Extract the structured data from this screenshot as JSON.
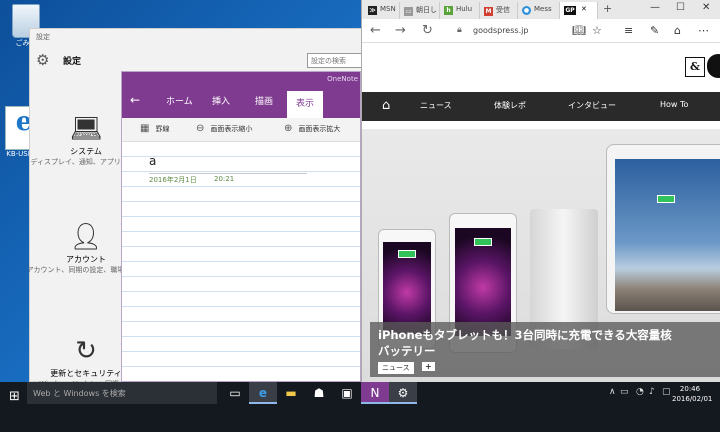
{
  "desktop": {
    "recycle_bin_label": "ごみ箱",
    "ie_shortcut_label": "KB-USB-..."
  },
  "settings": {
    "window_title": "設定",
    "heading": "設定",
    "search_placeholder": "設定の検索",
    "items": [
      {
        "title": "システム",
        "desc": "ディスプレイ、通知、アプリ、電源"
      },
      {
        "title": "アカウント",
        "desc": "アカウント、同期の設定、職場、家族"
      },
      {
        "title": "更新とセキュリティ",
        "desc": "Windows Update、回復、..."
      }
    ]
  },
  "onenote": {
    "app_title": "OneNote",
    "tabs": [
      "ホーム",
      "挿入",
      "描画",
      "表示"
    ],
    "active_tab": "表示",
    "ribbon": [
      "罫線",
      "画面表示縮小",
      "画面表示拡大"
    ],
    "page_title": "a",
    "page_date": "2016年2月1日",
    "page_time": "20:21"
  },
  "edge": {
    "tabs": [
      {
        "label": "MSN",
        "color": "#222222",
        "glyph": "≫"
      },
      {
        "label": "朝日し",
        "color": "#999999",
        "glyph": "▭"
      },
      {
        "label": "Hulu",
        "color": "#5aa33a",
        "glyph": "h"
      },
      {
        "label": "受信",
        "color": "#d23f31",
        "glyph": "M"
      },
      {
        "label": "Mess",
        "color": "#2f8fd8",
        "glyph": "●"
      },
      {
        "label": "GP",
        "color": "#111111",
        "glyph": "GP"
      }
    ],
    "url": "goodspress.jp",
    "logo_text": "&",
    "menu": [
      "ニュース",
      "体験レポ",
      "インタビュー",
      "How To"
    ],
    "hero_caption_line1": "iPhoneもタブレットも！3台同時に充電できる大容量核",
    "hero_caption_line2": "バッテリー",
    "hero_badge": "ニュース",
    "hero_plus": "+"
  },
  "taskbar": {
    "search_placeholder": "Web と Windows を検索",
    "time": "20:46",
    "date": "2016/02/01"
  }
}
